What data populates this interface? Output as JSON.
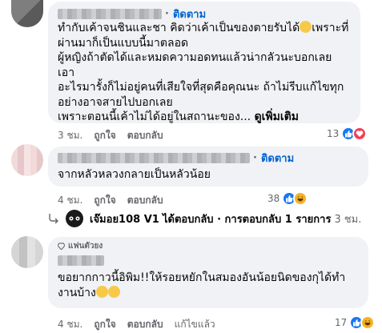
{
  "comments": [
    {
      "follow_label": "ติดตาม",
      "separator": "·",
      "text_lines": [
        "ทำกับเค้าจนชินและชา คิดว่าเค้าเป็นของตายรับได้",
        "เพราะที่",
        "ผ่านมาก็เป็นแบบนี้มาตลอด",
        "ผู้หญิงถ้าตัดได้และหมดความอดทนแล้วน่ากลัวนะบอกเลย เอา",
        "อะไรมารั้งก็ไม่อยู่คนที่เสียใจที่สุดคือคุณนะ ถ้าไม่รีบแก้ไขทุก",
        "อย่างอาจสายไปบอกเลย",
        "เพราะตอนนี้เค้าไม่ได้อยู่ในสถานะของ..."
      ],
      "see_more": "ดูเพิ่มเติม",
      "time": "3 ชม.",
      "like": "ถูกใจ",
      "reply": "ตอบกลับ",
      "reaction_count": "13",
      "reactions": [
        "like-icon",
        "love-icon"
      ]
    },
    {
      "follow_label": "ติดตาม",
      "separator": "·",
      "text": "จากหลัวหลวงกลายเป็นหลัวน้อย",
      "time": "4 ชม.",
      "like": "ถูกใจ",
      "reply": "ตอบกลับ",
      "reaction_count": "38",
      "reactions": [
        "like-icon",
        "haha-icon"
      ]
    },
    {
      "badge": "แฟนตัวยง",
      "text_line1": "ขอยากกาวนี้อิพิม!!ให้รอยหยักในสมองอันน้อยนิดของกุได้ทำ",
      "text_line2": "งานบ้าง",
      "time": "4 ชม.",
      "like": "ถูกใจ",
      "reply": "ตอบกลับ",
      "edited": "แก้ไขแล้ว",
      "reaction_count": "17",
      "reactions": [
        "like-icon",
        "haha-icon"
      ]
    }
  ],
  "reply_summary": {
    "name": "เจ๊มอย108 V1",
    "action": "ได้ตอบกลับ · การตอบกลับ 1 รายการ",
    "time": "3 ชม."
  },
  "colors": {
    "bubble": "#f0f2f5",
    "link": "#0064d1",
    "meta": "#65676b",
    "like": "#1877f2",
    "love": "#f33e58",
    "haha": "#f7b125"
  }
}
